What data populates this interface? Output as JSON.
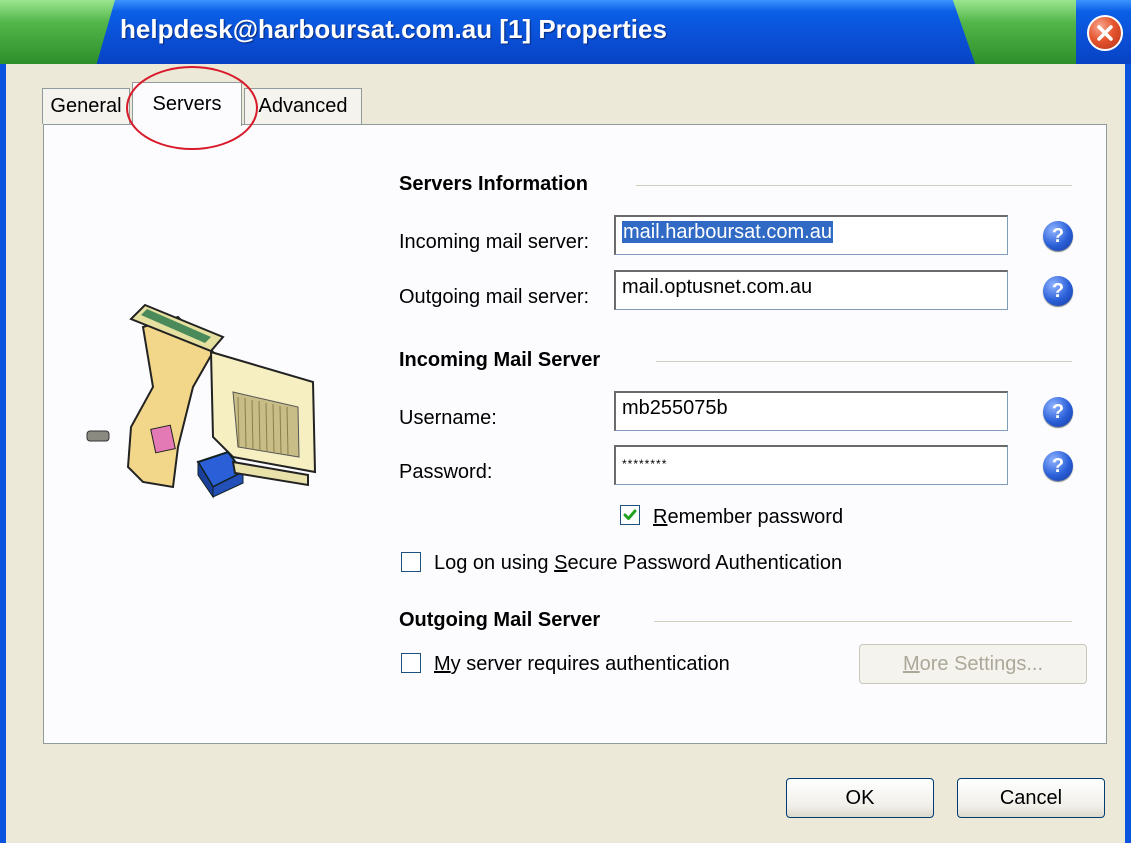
{
  "window": {
    "title": "helpdesk@harboursat.com.au [1] Properties"
  },
  "tabs": [
    {
      "label": "General",
      "selected": false
    },
    {
      "label": "Servers",
      "selected": true
    },
    {
      "label": "Advanced",
      "selected": false
    }
  ],
  "servers_info": {
    "heading": "Servers Information",
    "incoming_label": "Incoming mail server:",
    "incoming_value": "mail.harboursat.com.au",
    "outgoing_label": "Outgoing mail server:",
    "outgoing_value": "mail.optusnet.com.au"
  },
  "incoming_mail": {
    "heading": "Incoming Mail Server",
    "username_label": "Username:",
    "username_value": "mb255075b",
    "password_label": "Password:",
    "password_value": "********",
    "remember_before": "",
    "remember_accel": "R",
    "remember_after": "emember password",
    "remember_checked": true,
    "spa_before": "Log on using ",
    "spa_accel": "S",
    "spa_after": "ecure Password Authentication",
    "spa_checked": false
  },
  "outgoing_mail": {
    "heading": "Outgoing Mail Server",
    "auth_accel": "M",
    "auth_after": "y server requires authentication",
    "auth_checked": false,
    "more_accel": "M",
    "more_after": "ore Settings..."
  },
  "buttons": {
    "ok": "OK",
    "cancel": "Cancel"
  },
  "colors": {
    "titlebar": "#0a4fd6",
    "highlight_circle": "#d81b2a",
    "selection": "#316ac5"
  },
  "icons": {
    "help": "help-question-icon",
    "close": "close-x-icon",
    "illustration": "mail-server-computer-illustration"
  }
}
